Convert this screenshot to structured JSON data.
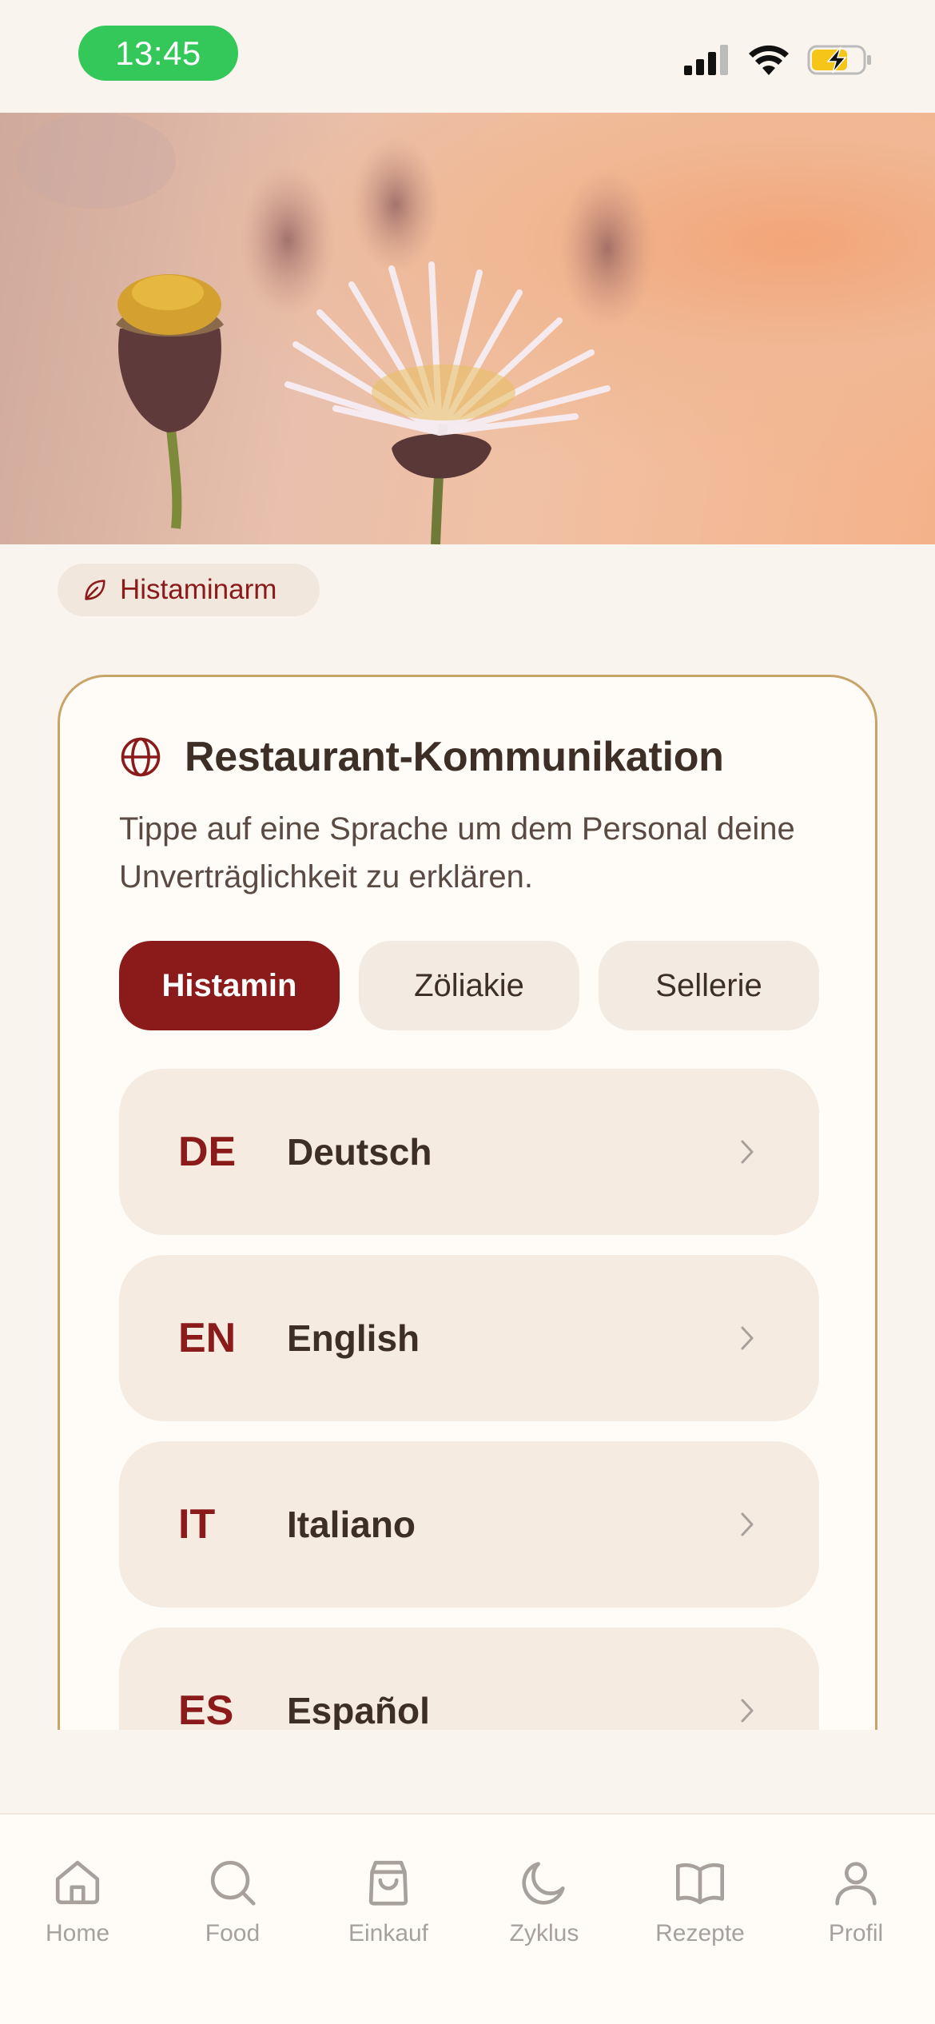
{
  "status_bar": {
    "time": "13:45"
  },
  "tag": {
    "label": "Histaminarm"
  },
  "card": {
    "title": "Restaurant-Kommunikation",
    "description": "Tippe auf eine Sprache um dem Personal deine Unverträglichkeit zu erklären.",
    "segments": [
      {
        "label": "Histamin",
        "active": true
      },
      {
        "label": "Zöliakie",
        "active": false
      },
      {
        "label": "Sellerie",
        "active": false
      }
    ],
    "languages": [
      {
        "code": "DE",
        "name": "Deutsch"
      },
      {
        "code": "EN",
        "name": "English"
      },
      {
        "code": "IT",
        "name": "Italiano"
      },
      {
        "code": "ES",
        "name": "Español"
      }
    ]
  },
  "nav": {
    "items": [
      {
        "label": "Home",
        "icon": "home-icon"
      },
      {
        "label": "Food",
        "icon": "search-icon"
      },
      {
        "label": "Einkauf",
        "icon": "shopping-bag-icon"
      },
      {
        "label": "Zyklus",
        "icon": "moon-icon"
      },
      {
        "label": "Rezepte",
        "icon": "book-icon"
      },
      {
        "label": "Profil",
        "icon": "user-icon"
      }
    ]
  },
  "colors": {
    "accent": "#8b1a1a",
    "background": "#faf4ee",
    "card_border": "#c9a46a",
    "status_green": "#34c759",
    "nav_inactive": "#a8a19b"
  }
}
